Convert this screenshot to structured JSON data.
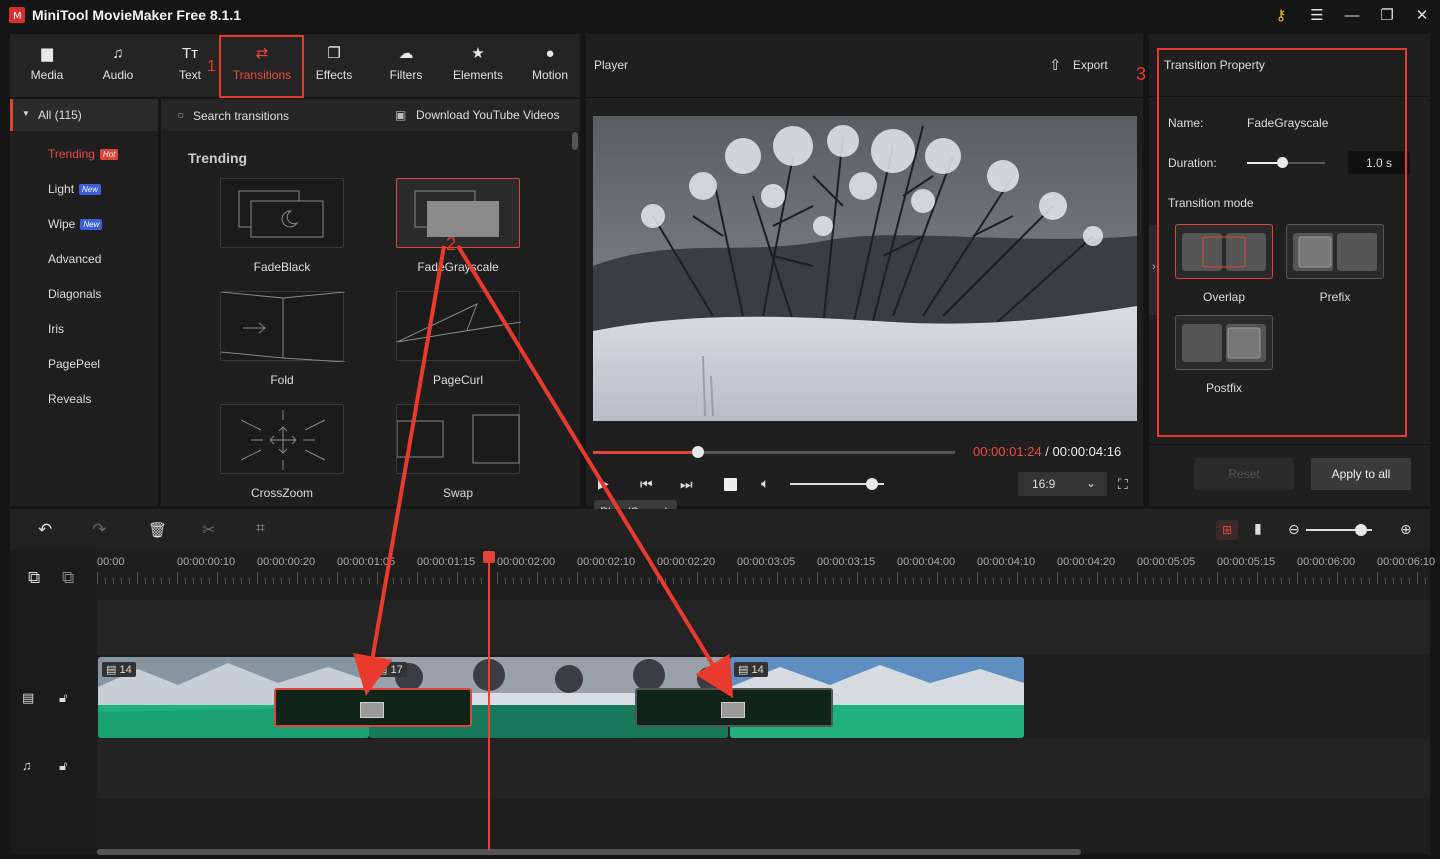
{
  "app": {
    "title": "MiniTool MovieMaker Free 8.1.1"
  },
  "toolbar": {
    "items": [
      {
        "label": "Media",
        "icon": "folder-icon"
      },
      {
        "label": "Audio",
        "icon": "music-note-icon"
      },
      {
        "label": "Text",
        "icon": "text-icon"
      },
      {
        "label": "Transitions",
        "icon": "transition-arrows-icon"
      },
      {
        "label": "Effects",
        "icon": "effects-icon"
      },
      {
        "label": "Filters",
        "icon": "filters-icon"
      },
      {
        "label": "Elements",
        "icon": "elements-icon"
      },
      {
        "label": "Motion",
        "icon": "motion-icon"
      }
    ]
  },
  "categories": {
    "all": "All (115)",
    "items": [
      {
        "label": "Trending",
        "badge": "Hot",
        "active": true
      },
      {
        "label": "Light",
        "badge": "New"
      },
      {
        "label": "Wipe",
        "badge": "New"
      },
      {
        "label": "Advanced"
      },
      {
        "label": "Diagonals"
      },
      {
        "label": "Iris"
      },
      {
        "label": "PagePeel"
      },
      {
        "label": "Reveals"
      }
    ]
  },
  "library": {
    "search_placeholder": "Search transitions",
    "download_label": "Download YouTube Videos",
    "section_title": "Trending",
    "items": [
      "FadeBlack",
      "FadeGrayscale",
      "Fold",
      "PageCurl",
      "CrossZoom",
      "Swap"
    ]
  },
  "player": {
    "title": "Player",
    "export_label": "Export",
    "current_time": "00:00:01:24",
    "separator": " / ",
    "total_time": "00:00:04:16",
    "progress": 0.29,
    "volume": 0.87,
    "aspect_ratio": "16:9",
    "tooltip": "Play (Space)"
  },
  "property": {
    "title": "Transition Property",
    "name_label": "Name:",
    "name_value": "FadeGrayscale",
    "duration_label": "Duration:",
    "duration_value": "1.0 s",
    "duration_level": 0.45,
    "mode_title": "Transition mode",
    "modes": [
      "Overlap",
      "Prefix",
      "Postfix"
    ],
    "reset_label": "Reset",
    "apply_label": "Apply to all"
  },
  "annotations": {
    "n1": "1",
    "n2": "2",
    "n3": "3"
  },
  "timeline": {
    "ticks": [
      "00:00",
      "00:00:00:10",
      "00:00:00:20",
      "00:00:01:05",
      "00:00:01:15",
      "00:00:02:00",
      "00:00:02:10",
      "00:00:02:20",
      "00:00:03:05",
      "00:00:03:15",
      "00:00:04:00",
      "00:00:04:10",
      "00:00:04:20",
      "00:00:05:05",
      "00:00:05:15",
      "00:00:06:00",
      "00:00:06:10"
    ],
    "clips": [
      {
        "duration": "14"
      },
      {
        "duration": "17"
      },
      {
        "duration": "14"
      }
    ],
    "zoom_level": 0.83
  },
  "colors": {
    "accent": "#e0443a",
    "annotation": "#e83a2d",
    "audio_wave": "#1fb07d"
  }
}
